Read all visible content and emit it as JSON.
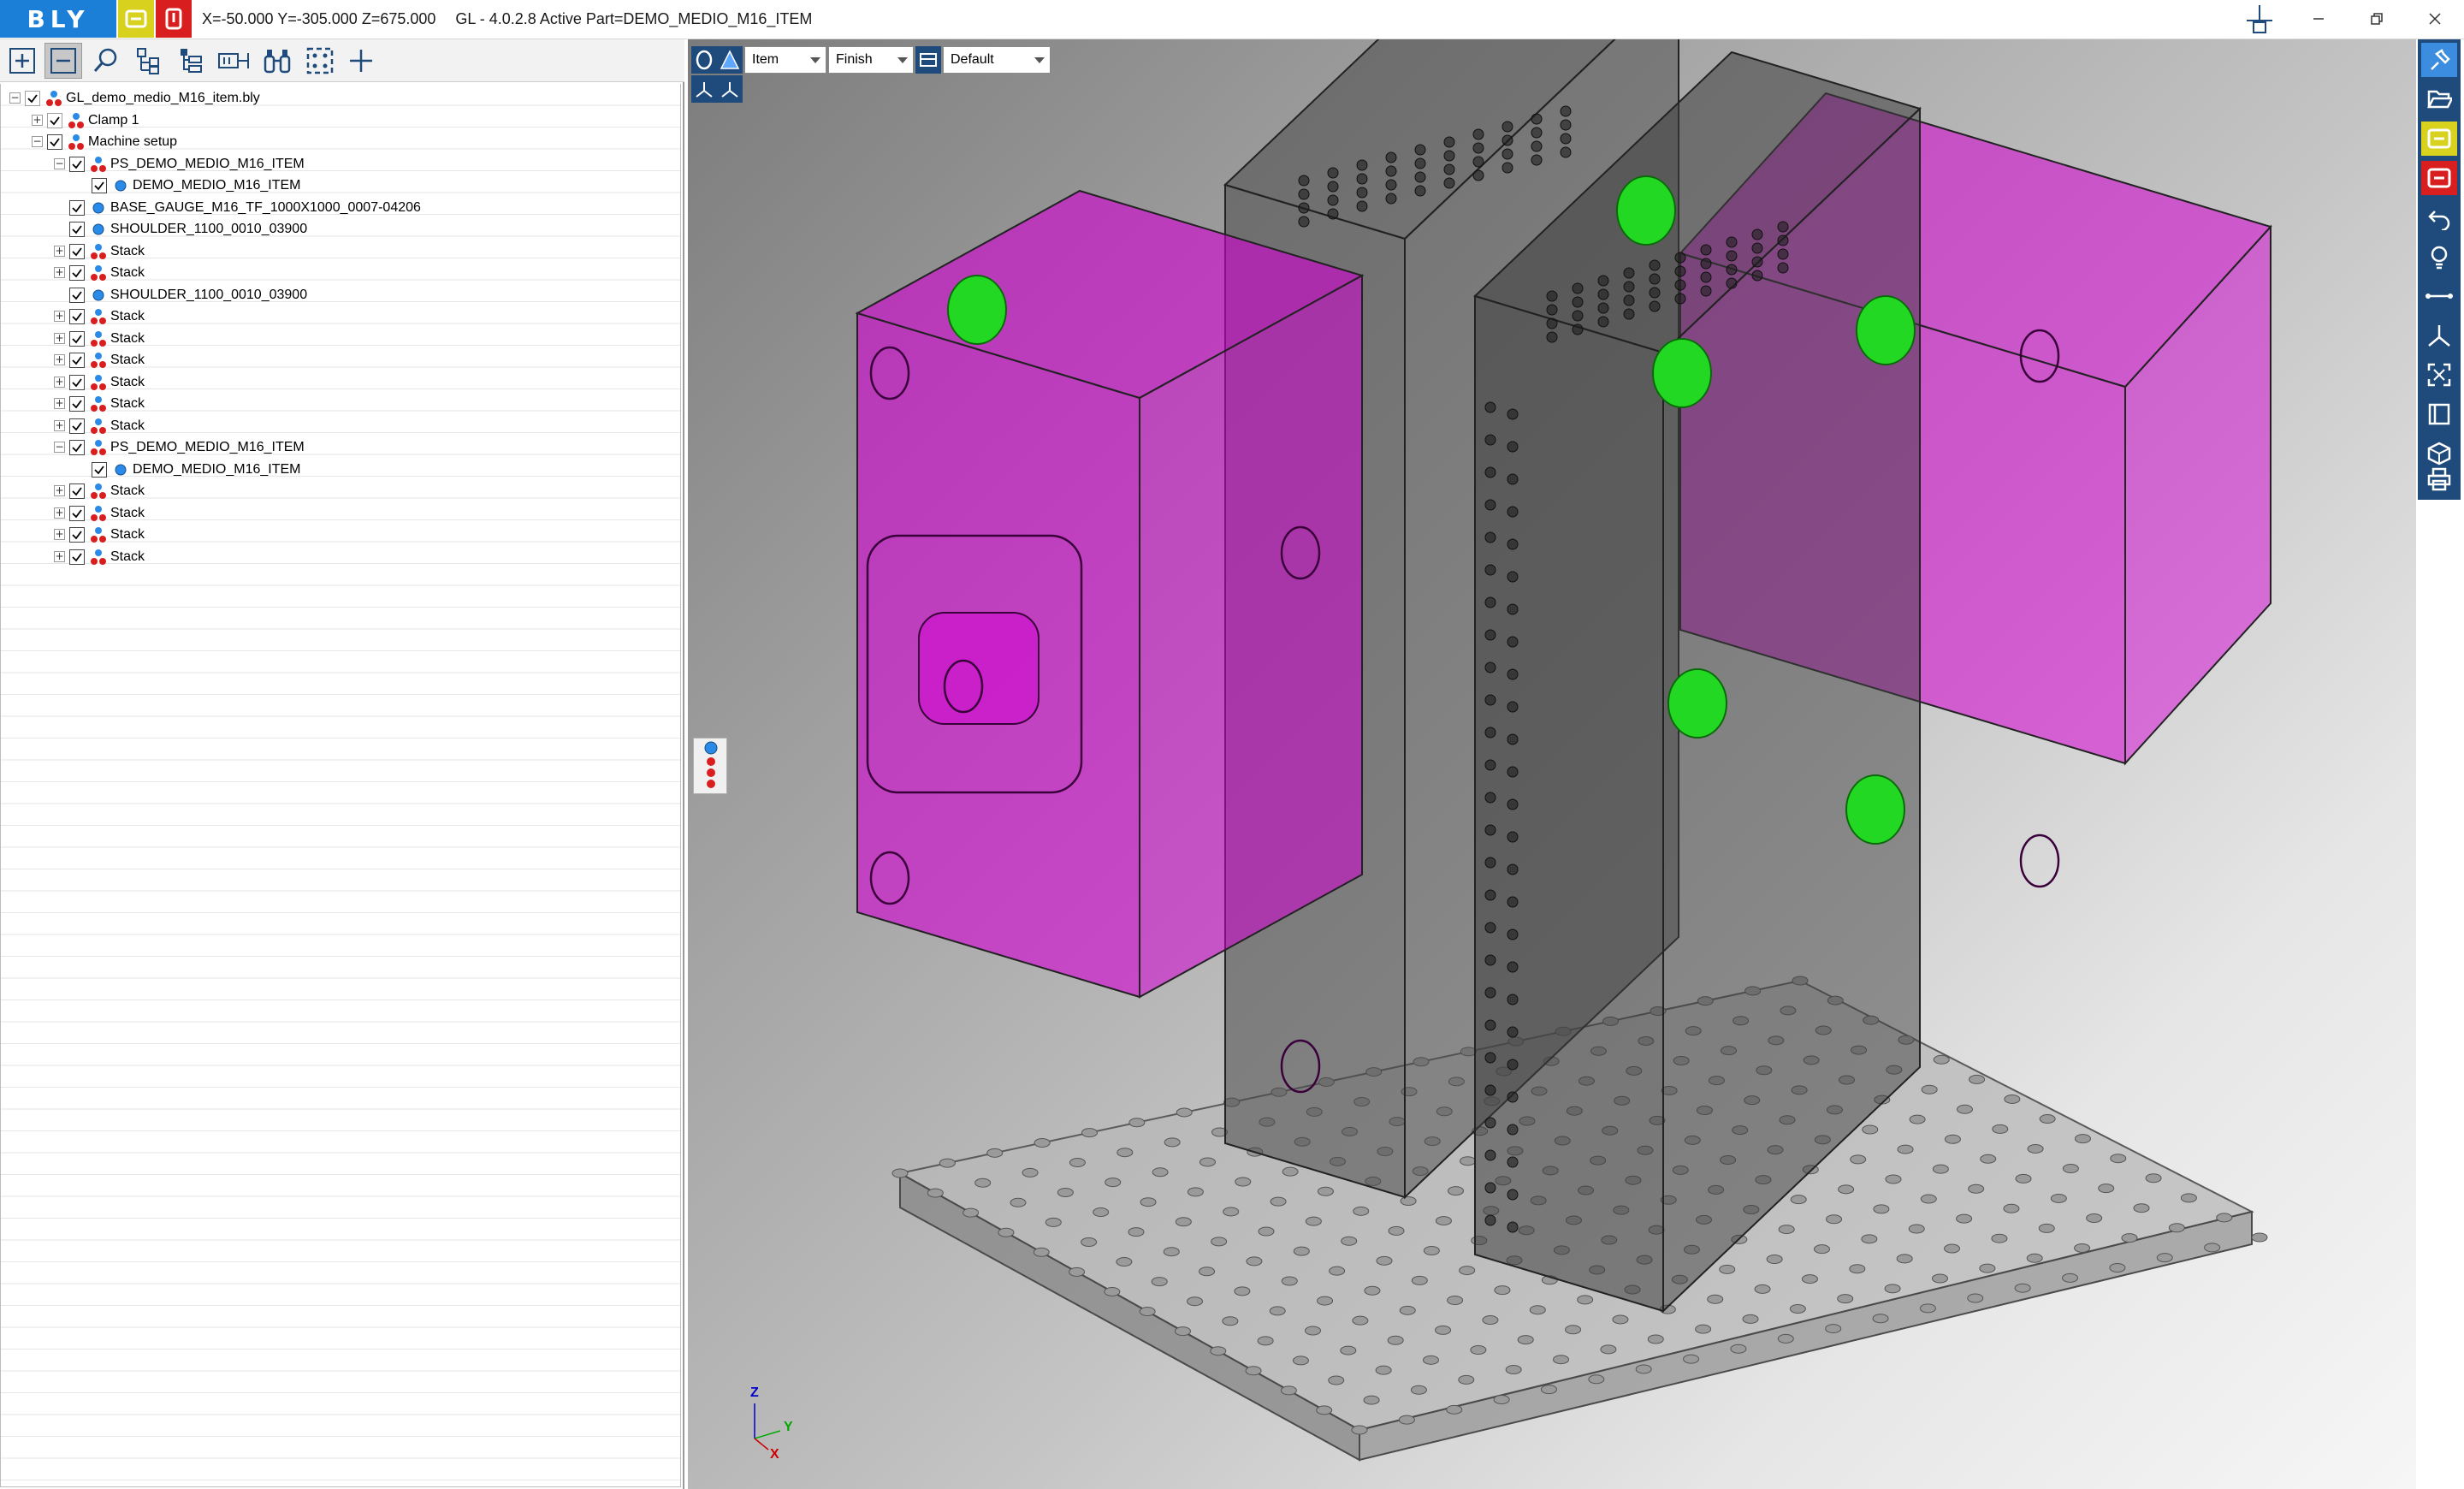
{
  "app": {
    "logo_text": "BLY",
    "coords": "X=-50.000 Y=-305.000 Z=675.000",
    "title": "GL - 4.0.2.8 Active Part=DEMO_MEDIO_M16_ITEM"
  },
  "colors": {
    "brand_blue": "#1b7fd8",
    "toolbar_navy": "#1f4a7c",
    "accent_yellow": "#d8d21e",
    "accent_red": "#d81e1e",
    "part_magenta": "#d400d4",
    "pin_green": "#22d822"
  },
  "window_controls": [
    "minimize-icon",
    "restore-icon",
    "close-icon"
  ],
  "tree_toolbar": [
    "expand-all-icon",
    "collapse-all-icon",
    "search-icon",
    "hierarchy-icon",
    "tree-structure-icon",
    "gauge-icon",
    "binoculars-icon",
    "select-frame-icon",
    "add-icon"
  ],
  "tree": [
    {
      "label": "GL_demo_medio_M16_item.bly",
      "level": 0,
      "expander": "−",
      "checked": true,
      "dim": true,
      "icon": "assembly"
    },
    {
      "label": "Clamp 1",
      "level": 1,
      "expander": "+",
      "checked": true,
      "dim": true,
      "icon": "assembly"
    },
    {
      "label": "Machine setup",
      "level": 1,
      "expander": "−",
      "checked": true,
      "dim": false,
      "icon": "assembly"
    },
    {
      "label": "PS_DEMO_MEDIO_M16_ITEM",
      "level": 2,
      "expander": "−",
      "checked": true,
      "dim": false,
      "icon": "assembly"
    },
    {
      "label": "DEMO_MEDIO_M16_ITEM",
      "level": 3,
      "expander": "",
      "checked": true,
      "dim": false,
      "icon": "part"
    },
    {
      "label": "BASE_GAUGE_M16_TF_1000X1000_0007-04206",
      "level": 2,
      "expander": "",
      "checked": true,
      "dim": false,
      "icon": "part"
    },
    {
      "label": "SHOULDER_1100_0010_03900",
      "level": 2,
      "expander": "",
      "checked": true,
      "dim": false,
      "icon": "part"
    },
    {
      "label": "Stack",
      "level": 2,
      "expander": "+",
      "checked": true,
      "dim": false,
      "icon": "assembly"
    },
    {
      "label": "Stack",
      "level": 2,
      "expander": "+",
      "checked": true,
      "dim": false,
      "icon": "assembly"
    },
    {
      "label": "SHOULDER_1100_0010_03900",
      "level": 2,
      "expander": "",
      "checked": true,
      "dim": false,
      "icon": "part"
    },
    {
      "label": "Stack",
      "level": 2,
      "expander": "+",
      "checked": true,
      "dim": false,
      "icon": "assembly"
    },
    {
      "label": "Stack",
      "level": 2,
      "expander": "+",
      "checked": true,
      "dim": false,
      "icon": "assembly"
    },
    {
      "label": "Stack",
      "level": 2,
      "expander": "+",
      "checked": true,
      "dim": false,
      "icon": "assembly"
    },
    {
      "label": "Stack",
      "level": 2,
      "expander": "+",
      "checked": true,
      "dim": false,
      "icon": "assembly"
    },
    {
      "label": "Stack",
      "level": 2,
      "expander": "+",
      "checked": true,
      "dim": false,
      "icon": "assembly"
    },
    {
      "label": "Stack",
      "level": 2,
      "expander": "+",
      "checked": true,
      "dim": false,
      "icon": "assembly"
    },
    {
      "label": "PS_DEMO_MEDIO_M16_ITEM",
      "level": 2,
      "expander": "−",
      "checked": true,
      "dim": false,
      "icon": "assembly"
    },
    {
      "label": "DEMO_MEDIO_M16_ITEM",
      "level": 3,
      "expander": "",
      "checked": true,
      "dim": false,
      "icon": "part"
    },
    {
      "label": "Stack",
      "level": 2,
      "expander": "+",
      "checked": true,
      "dim": false,
      "icon": "assembly"
    },
    {
      "label": "Stack",
      "level": 2,
      "expander": "+",
      "checked": true,
      "dim": false,
      "icon": "assembly"
    },
    {
      "label": "Stack",
      "level": 2,
      "expander": "+",
      "checked": true,
      "dim": false,
      "icon": "assembly"
    },
    {
      "label": "Stack",
      "level": 2,
      "expander": "+",
      "checked": true,
      "dim": false,
      "icon": "assembly"
    }
  ],
  "viewport": {
    "mode_select": "Item",
    "quality_select": "Finish",
    "view_select": "Default",
    "axis": {
      "z": "Z",
      "y": "Y",
      "x": "X"
    }
  },
  "right_toolbar": [
    "pin-icon",
    "open-folder-icon",
    "bly-yellow-icon",
    "bly-red-icon",
    "undo-icon",
    "light-bulb-icon",
    "measure-icon",
    "axes-icon",
    "fit-view-icon",
    "clip-view-icon",
    "view-cube-icon",
    "print-icon"
  ]
}
